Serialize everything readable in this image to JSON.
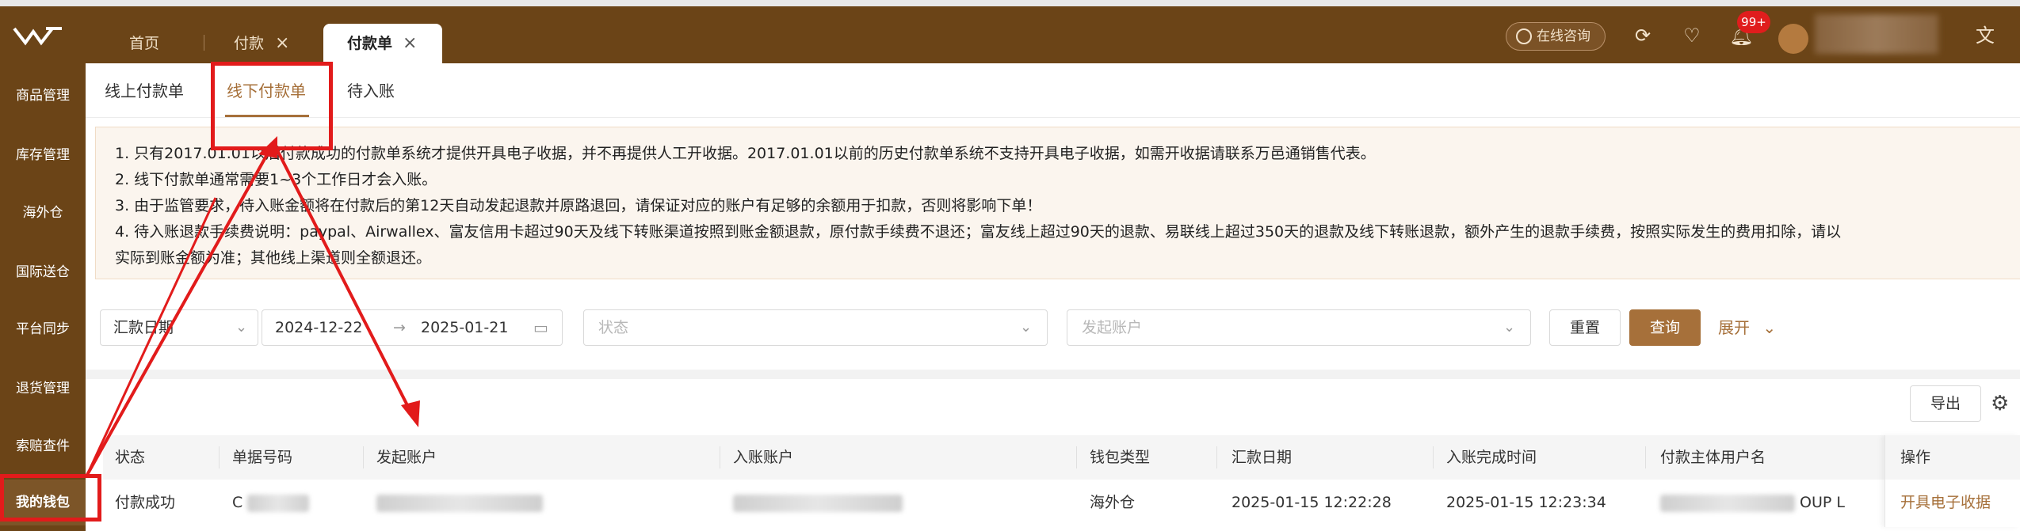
{
  "header": {
    "tabs": [
      {
        "label": "首页"
      },
      {
        "label": "付款"
      },
      {
        "label": "付款单",
        "active": true
      }
    ],
    "consult_label": "在线咨询",
    "notification_badge": "99+",
    "icons": [
      "refresh-icon",
      "heart-icon",
      "bell-icon",
      "translate-icon"
    ]
  },
  "sidebar": {
    "items": [
      {
        "label": "商品管理"
      },
      {
        "label": "库存管理"
      },
      {
        "label": "海外仓"
      },
      {
        "label": "国际送仓"
      },
      {
        "label": "平台同步"
      },
      {
        "label": "退货管理"
      },
      {
        "label": "索赔查件"
      },
      {
        "label": "我的钱包",
        "active": true
      }
    ]
  },
  "subtabs": [
    {
      "label": "线上付款单"
    },
    {
      "label": "线下付款单",
      "active": true
    },
    {
      "label": "待入账"
    }
  ],
  "notice": [
    "1. 只有2017.01.01以后付款成功的付款单系统才提供开具电子收据，并不再提供人工开收据。2017.01.01以前的历史付款单系统不支持开具电子收据，如需开收据请联系万邑通销售代表。",
    "2. 线下付款单通常需要1~3个工作日才会入账。",
    "3. 由于监管要求，待入账金额将在付款后的第12天自动发起退款并原路退回，请保证对应的账户有足够的余额用于扣款，否则将影响下单！",
    "4. 待入账退款手续费说明：paypal、Airwallex、富友信用卡超过90天及线下转账渠道按照到账金额退款，原付款手续费不退还；富友线上超过90天的退款、易联线上超过350天的退款及线下转账退款，额外产生的退款手续费，按照实际发生的费用扣除，请以",
    "实际到账金额为准；其他线上渠道则全额退还。"
  ],
  "filters": {
    "date_type": "汇款日期",
    "date_start": "2024-12-22",
    "date_arrow": "→",
    "date_end": "2025-01-21",
    "status_placeholder": "状态",
    "account_placeholder": "发起账户",
    "reset_label": "重置",
    "query_label": "查询",
    "expand_label": "展开"
  },
  "toolbar": {
    "export_label": "导出"
  },
  "table": {
    "columns": [
      "状态",
      "单据号码",
      "发起账户",
      "入账账户",
      "钱包类型",
      "汇款日期",
      "入账完成时间",
      "付款主体用户名",
      "操作"
    ],
    "rows": [
      {
        "status": "付款成功",
        "doc_no_prefix": "C",
        "wallet_type": "海外仓",
        "remit_date": "2025-01-15 12:22:28",
        "complete_time": "2025-01-15 12:23:34",
        "user_suffix": "OUP L",
        "action": "开具电子收据"
      }
    ]
  },
  "colors": {
    "brand_brown": "#6b4417",
    "accent": "#a6703a",
    "annotation_red": "#e21b1b"
  }
}
